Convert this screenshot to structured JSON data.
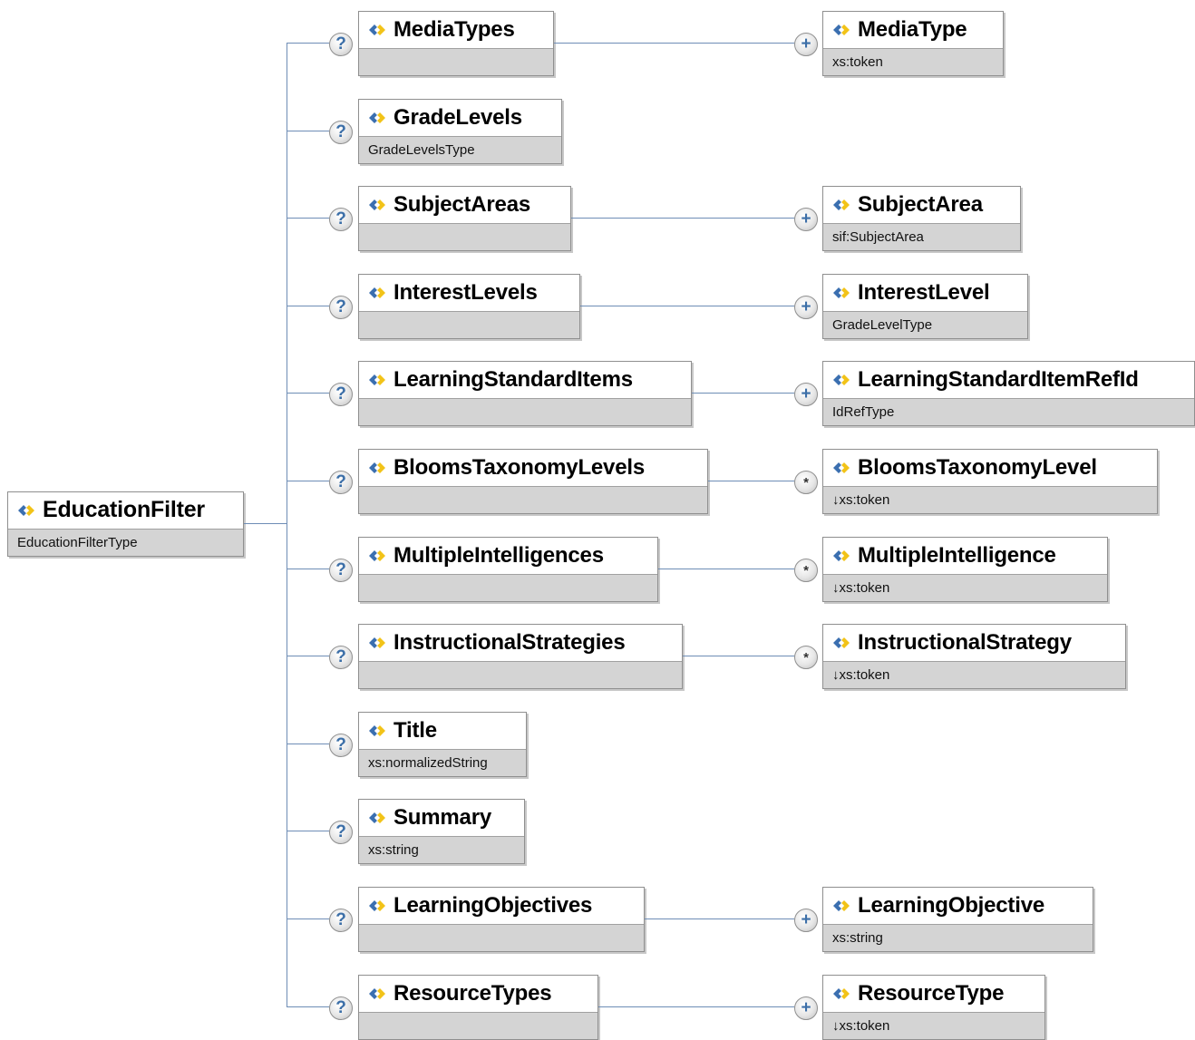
{
  "root": {
    "name": "EducationFilter",
    "type": "EducationFilterType"
  },
  "elements": [
    {
      "name": "MediaTypes",
      "type": "",
      "badge": "?",
      "child": {
        "name": "MediaType",
        "type": "xs:token",
        "badge": "+"
      }
    },
    {
      "name": "GradeLevels",
      "type": "GradeLevelsType",
      "badge": "?"
    },
    {
      "name": "SubjectAreas",
      "type": "",
      "badge": "?",
      "child": {
        "name": "SubjectArea",
        "type": "sif:SubjectArea",
        "badge": "+"
      }
    },
    {
      "name": "InterestLevels",
      "type": "",
      "badge": "?",
      "child": {
        "name": "InterestLevel",
        "type": "GradeLevelType",
        "badge": "+"
      }
    },
    {
      "name": "LearningStandardItems",
      "type": "",
      "badge": "?",
      "child": {
        "name": "LearningStandardItemRefId",
        "type": "IdRefType",
        "badge": "+"
      }
    },
    {
      "name": "BloomsTaxonomyLevels",
      "type": "",
      "badge": "?",
      "child": {
        "name": "BloomsTaxonomyLevel",
        "type": "↓xs:token",
        "badge": "*"
      }
    },
    {
      "name": "MultipleIntelligences",
      "type": "",
      "badge": "?",
      "child": {
        "name": "MultipleIntelligence",
        "type": "↓xs:token",
        "badge": "*"
      }
    },
    {
      "name": "InstructionalStrategies",
      "type": "",
      "badge": "?",
      "child": {
        "name": "InstructionalStrategy",
        "type": "↓xs:token",
        "badge": "*"
      }
    },
    {
      "name": "Title",
      "type": "xs:normalizedString",
      "badge": "?"
    },
    {
      "name": "Summary",
      "type": "xs:string",
      "badge": "?"
    },
    {
      "name": "LearningObjectives",
      "type": "",
      "badge": "?",
      "child": {
        "name": "LearningObjective",
        "type": "xs:string",
        "badge": "+"
      }
    },
    {
      "name": "ResourceTypes",
      "type": "",
      "badge": "?",
      "child": {
        "name": "ResourceType",
        "type": "↓xs:token",
        "badge": "+"
      }
    }
  ],
  "colors": {
    "connector": "#6e8db6",
    "icon_blue": "#3b6fb0",
    "icon_yellow": "#f2c318",
    "type_bar": "#d4d4d4"
  },
  "icons": {
    "element": "element-icon",
    "optional": "question-icon",
    "one_or_more": "plus-icon",
    "zero_or_more": "star-icon"
  }
}
